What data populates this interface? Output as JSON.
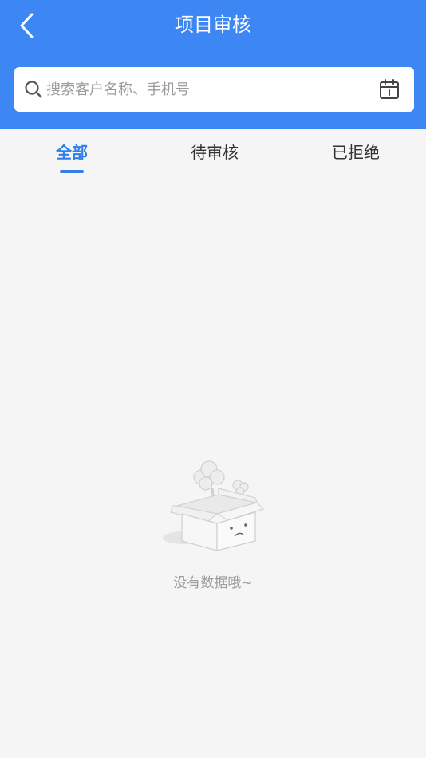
{
  "header": {
    "title": "项目审核",
    "background": "#3d87f5"
  },
  "search": {
    "placeholder": "搜索客户名称、手机号",
    "value": ""
  },
  "icons": {
    "back": "chevron-left-icon",
    "search": "search-icon",
    "calendar": "calendar-icon"
  },
  "tabs": [
    {
      "label": "全部",
      "active": true
    },
    {
      "label": "待审核",
      "active": false
    },
    {
      "label": "已拒绝",
      "active": false
    }
  ],
  "accent_color": "#2f7fef",
  "empty_state": {
    "message": "没有数据哦~",
    "illustration": "empty-box-illustration"
  }
}
